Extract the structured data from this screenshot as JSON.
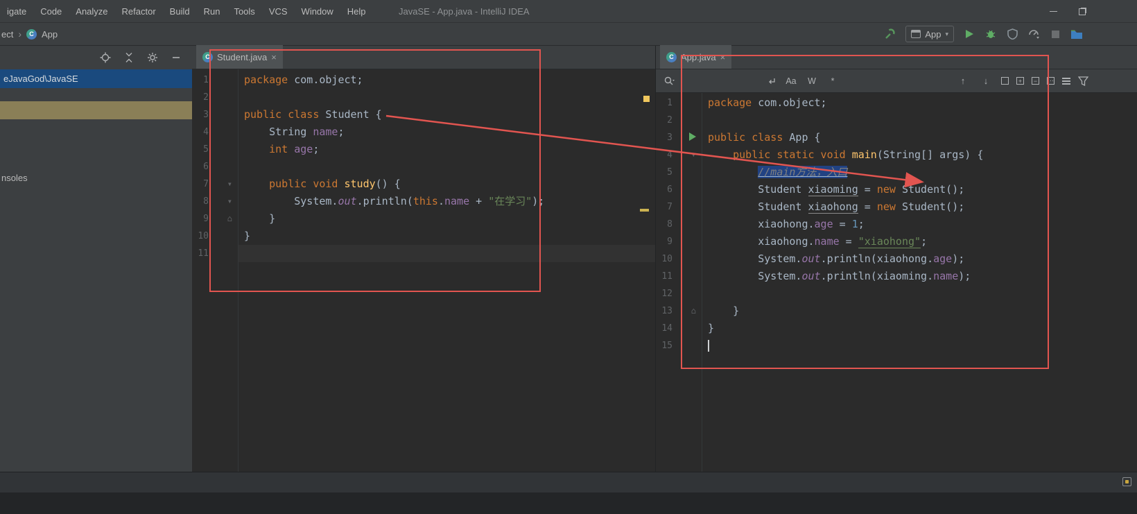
{
  "window": {
    "title": "JavaSE - App.java - IntelliJ IDEA"
  },
  "menubar": {
    "items": [
      {
        "label": "igate"
      },
      {
        "label": "Code"
      },
      {
        "label": "Analyze"
      },
      {
        "label": "Refactor"
      },
      {
        "label": "Build"
      },
      {
        "label": "Run"
      },
      {
        "label": "Tools"
      },
      {
        "label": "VCS"
      },
      {
        "label": "Window"
      },
      {
        "label": "Help"
      }
    ]
  },
  "toolbar": {
    "breadcrumb": {
      "root": "ect",
      "current": "App"
    },
    "run_config": {
      "label": "App"
    }
  },
  "project_panel": {
    "selected_item": "eJavaGod\\JavaSE",
    "partial_label": "nsoles"
  },
  "left_editor": {
    "tab": {
      "label": "Student.java"
    },
    "lines": [
      {
        "n": 1,
        "segs": [
          [
            "kw",
            "package"
          ],
          [
            "pl",
            " com.object;"
          ]
        ]
      },
      {
        "n": 2,
        "segs": []
      },
      {
        "n": 3,
        "segs": [
          [
            "kw",
            "public class"
          ],
          [
            "pl",
            " Student {"
          ]
        ]
      },
      {
        "n": 4,
        "segs": [
          [
            "pl",
            "    String "
          ],
          [
            "fld",
            "name"
          ],
          [
            "pl",
            ";"
          ]
        ]
      },
      {
        "n": 5,
        "segs": [
          [
            "pl",
            "    "
          ],
          [
            "kw",
            "int"
          ],
          [
            "pl",
            " "
          ],
          [
            "fld",
            "age"
          ],
          [
            "pl",
            ";"
          ]
        ]
      },
      {
        "n": 6,
        "segs": []
      },
      {
        "n": 7,
        "gutter": "fold-open",
        "segs": [
          [
            "pl",
            "    "
          ],
          [
            "kw",
            "public void"
          ],
          [
            "pl",
            " "
          ],
          [
            "mth",
            "study"
          ],
          [
            "pl",
            "() {"
          ]
        ]
      },
      {
        "n": 8,
        "gutter": "fold-open",
        "segs": [
          [
            "pl",
            "        System."
          ],
          [
            "stf",
            "out"
          ],
          [
            "pl",
            ".println("
          ],
          [
            "kw",
            "this"
          ],
          [
            "pl",
            "."
          ],
          [
            "fld",
            "name"
          ],
          [
            "pl",
            " + "
          ],
          [
            "str",
            "\"在学习\""
          ],
          [
            "pl",
            ");"
          ]
        ]
      },
      {
        "n": 9,
        "gutter": "fold-close",
        "segs": [
          [
            "pl",
            "    }"
          ]
        ]
      },
      {
        "n": 10,
        "segs": [
          [
            "pl",
            "}"
          ]
        ]
      },
      {
        "n": 11,
        "current": true,
        "segs": []
      }
    ]
  },
  "right_editor": {
    "tab": {
      "label": "App.java"
    },
    "search_bar": {
      "match_case": "Aa",
      "words": "W",
      "regex": "*"
    },
    "lines": [
      {
        "n": 1,
        "segs": [
          [
            "kw",
            "package"
          ],
          [
            "pl",
            " com.object;"
          ]
        ]
      },
      {
        "n": 2,
        "segs": []
      },
      {
        "n": 3,
        "gutter": "run",
        "segs": [
          [
            "kw",
            "public class"
          ],
          [
            "pl",
            " App {"
          ]
        ]
      },
      {
        "n": 4,
        "gutter": "fold-open",
        "segs": [
          [
            "pl",
            "    "
          ],
          [
            "kw",
            "public static void"
          ],
          [
            "pl",
            " "
          ],
          [
            "mth",
            "main"
          ],
          [
            "pl",
            "(String[] args) {"
          ]
        ]
      },
      {
        "n": 5,
        "segs": [
          [
            "pl",
            "        "
          ],
          [
            "selcmt",
            "//main方法，入口"
          ]
        ]
      },
      {
        "n": 6,
        "segs": [
          [
            "pl",
            "        Student "
          ],
          [
            "und",
            "xiaoming"
          ],
          [
            "pl",
            " = "
          ],
          [
            "kw",
            "new"
          ],
          [
            "pl",
            " Student();"
          ]
        ]
      },
      {
        "n": 7,
        "segs": [
          [
            "pl",
            "        Student "
          ],
          [
            "und",
            "xiaohong"
          ],
          [
            "pl",
            " = "
          ],
          [
            "kw",
            "new"
          ],
          [
            "pl",
            " Student();"
          ]
        ]
      },
      {
        "n": 8,
        "segs": [
          [
            "pl",
            "        xiaohong."
          ],
          [
            "fld",
            "age"
          ],
          [
            "pl",
            " = "
          ],
          [
            "num",
            "1"
          ],
          [
            "pl",
            ";"
          ]
        ]
      },
      {
        "n": 9,
        "segs": [
          [
            "pl",
            "        xiaohong."
          ],
          [
            "fld",
            "name"
          ],
          [
            "pl",
            " = "
          ],
          [
            "strund",
            "\"xiaohong\""
          ],
          [
            "pl",
            ";"
          ]
        ]
      },
      {
        "n": 10,
        "segs": [
          [
            "pl",
            "        System."
          ],
          [
            "stf",
            "out"
          ],
          [
            "pl",
            ".println(xiaohong."
          ],
          [
            "fld",
            "age"
          ],
          [
            "pl",
            ");"
          ]
        ]
      },
      {
        "n": 11,
        "segs": [
          [
            "pl",
            "        System."
          ],
          [
            "stf",
            "out"
          ],
          [
            "pl",
            ".println(xiaoming."
          ],
          [
            "fld",
            "name"
          ],
          [
            "pl",
            ");"
          ]
        ]
      },
      {
        "n": 12,
        "segs": []
      },
      {
        "n": 13,
        "gutter": "fold-close",
        "segs": [
          [
            "pl",
            "    }"
          ]
        ]
      },
      {
        "n": 14,
        "segs": [
          [
            "pl",
            "}"
          ]
        ]
      },
      {
        "n": 15,
        "caret": true,
        "segs": []
      }
    ]
  },
  "icons": {
    "breadcrumb_separator": "›",
    "class_letter": "C",
    "close_tab": "×",
    "dropdown_arrow": "▾",
    "fold_open": "▾",
    "fold_close": "⌂",
    "arrow_up": "↑",
    "arrow_down": "↓"
  },
  "palette": {
    "keyword": "#cc7832",
    "plain": "#a9b7c6",
    "field": "#9876aa",
    "string": "#6a8759",
    "number": "#6897bb",
    "comment": "#808080",
    "method": "#ffc66d",
    "selection": "#214283",
    "annotation_red": "#e25550",
    "run_green": "#5fad65",
    "warning_yellow": "#f0c75e",
    "editor_bg": "#2b2b2b",
    "panel_bg": "#3c3f41",
    "tab_selected_bg": "#4e5254",
    "selected_row_blue": "#1a4a7e",
    "olive_row": "#8a7f57",
    "line_number": "#606366",
    "menu_text": "#bbbbbb",
    "current_line": "#323232"
  }
}
